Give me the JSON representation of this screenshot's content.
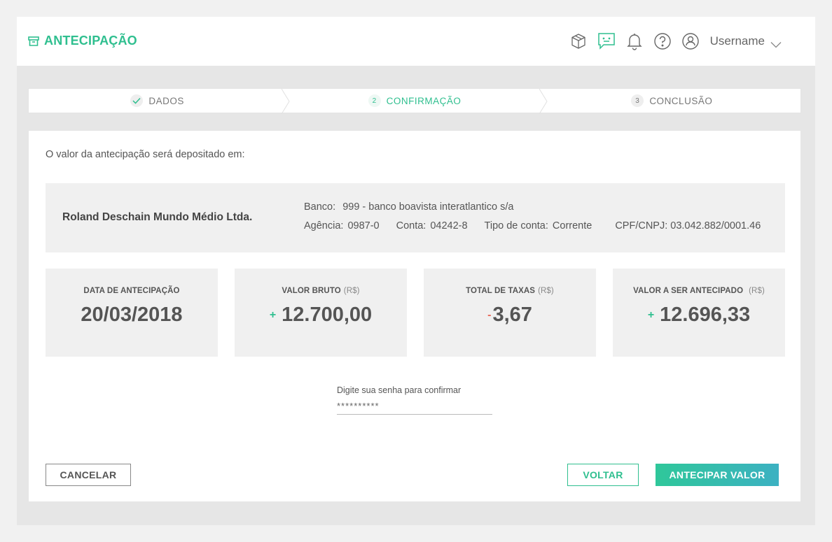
{
  "app": {
    "title": "ANTECIPAÇÃO",
    "username": "Username"
  },
  "colors": {
    "accent": "#2fbf8f",
    "negative": "#e86a5a",
    "button_gradient_start": "#2fc79a",
    "button_gradient_end": "#3cb1c2"
  },
  "header_icons": [
    "box-icon",
    "chat-icon",
    "bell-icon",
    "help-icon",
    "user-icon"
  ],
  "stepper": {
    "steps": [
      {
        "num": "",
        "label": "DADOS",
        "state": "done"
      },
      {
        "num": "2",
        "label": "CONFIRMAÇÃO",
        "state": "active"
      },
      {
        "num": "3",
        "label": "CONCLUSÃO",
        "state": "pending"
      }
    ]
  },
  "deposit": {
    "intro": "O valor da antecipação será depositado em:",
    "company": "Roland Deschain Mundo Médio Ltda.",
    "banco_label": "Banco:",
    "banco_value": "999 - banco boavista interatlantico s/a",
    "agencia_label": "Agência:",
    "agencia_value": "0987-0",
    "conta_label": "Conta:",
    "conta_value": "04242-8",
    "tipo_label": "Tipo de conta:",
    "tipo_value": "Corrente",
    "cpf_label": "CPF/CNPJ:",
    "cpf_value": "03.042.882/0001.46"
  },
  "stats": [
    {
      "label": "DATA DE ANTECIPAÇÃO",
      "unit": "",
      "sign": "",
      "value": "20/03/2018"
    },
    {
      "label": "VALOR BRUTO",
      "unit": "(R$)",
      "sign": "+",
      "value": "12.700,00"
    },
    {
      "label": "TOTAL DE TAXAS",
      "unit": "(R$)",
      "sign": "-",
      "value": "3,67"
    },
    {
      "label": "VALOR A SER ANTECIPADO",
      "unit": "(R$)",
      "sign": "+",
      "value": "12.696,33"
    }
  ],
  "password": {
    "label": "Digite sua senha para confirmar",
    "value": "**********"
  },
  "buttons": {
    "cancel": "CANCELAR",
    "back": "VOLTAR",
    "confirm": "ANTECIPAR VALOR"
  }
}
